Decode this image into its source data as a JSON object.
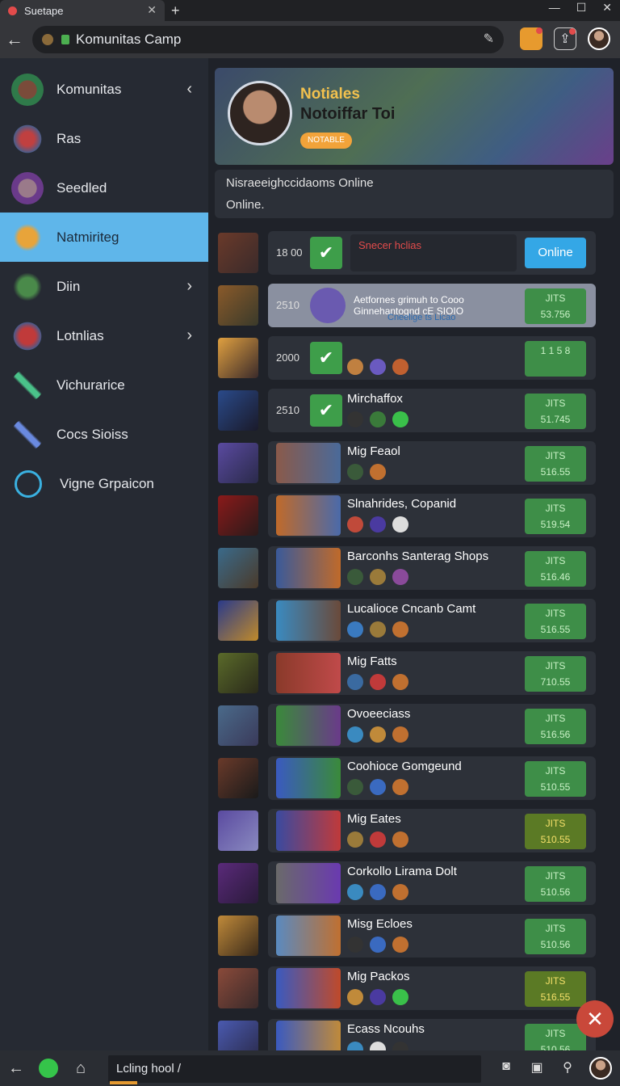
{
  "tab": {
    "title": "Suetape"
  },
  "address": {
    "url": "Komunitas Camp"
  },
  "sidebar": {
    "items": [
      {
        "label": "Komunitas",
        "icon": "shield-icon",
        "chevron": "‹"
      },
      {
        "label": "Ras",
        "icon": "warrior-icon"
      },
      {
        "label": "Seedled",
        "icon": "badge-icon"
      },
      {
        "label": "Natmiriteg",
        "icon": "star-icon",
        "active": true
      },
      {
        "label": "Diin",
        "icon": "dragon-icon",
        "chevron": "›"
      },
      {
        "label": "Lotnlias",
        "icon": "demon-icon",
        "chevron": "›"
      },
      {
        "label": "Vichurarice",
        "icon": "sword-icon"
      },
      {
        "label": "Cocs Sioiss",
        "icon": "dagger-icon"
      },
      {
        "label": "Vigne Grpaicon",
        "icon": "heart-icon"
      }
    ]
  },
  "banner": {
    "line1": "Notiales",
    "line2": "Notoiffar Toi",
    "button": "NOTABLE"
  },
  "info": {
    "line1": "Nisraeeighccidaoms Online",
    "line2": "Online."
  },
  "rows": [
    {
      "num": "18 00",
      "check": true,
      "title": "Snecer hclias",
      "online": "Online"
    },
    {
      "num": "2510",
      "title": "Aetfornes grimuh to Cooo Ginnehantognd cE SIOIO",
      "sub": "Cneelige ts Licao",
      "score1": "JITS",
      "score2": "53.756"
    },
    {
      "num": "2000",
      "check": true,
      "score1": "1 1 5 8",
      "score2": ""
    },
    {
      "num": "2510",
      "check": true,
      "title": "Mirchaffox",
      "score1": "JITS",
      "score2": "51.745"
    },
    {
      "title": "Mig Feaol",
      "score1": "JITS",
      "score2": "516.55"
    },
    {
      "title": "Slnahrides, Copanid",
      "score1": "JITS",
      "score2": "519.54"
    },
    {
      "title": "Barconhs Santerag Shops",
      "score1": "JITS",
      "score2": "516.46"
    },
    {
      "title": "Lucalioce Cncanb Camt",
      "score1": "JITS",
      "score2": "516.55"
    },
    {
      "title": "Mig Fatts",
      "score1": "JITS",
      "score2": "710.55"
    },
    {
      "title": "Ovoeeciass",
      "score1": "JITS",
      "score2": "516.56"
    },
    {
      "title": "Coohioce Gomgeund",
      "score1": "JITS",
      "score2": "510.55"
    },
    {
      "title": "Mig Eates",
      "score1": "JITS",
      "score2": "510.55",
      "gold": true
    },
    {
      "title": "Corkollo Lirama Dolt",
      "score1": "JITS",
      "score2": "510.56"
    },
    {
      "title": "Misg Ecloes",
      "score1": "JITS",
      "score2": "510.56"
    },
    {
      "title": "Mig Packos",
      "score1": "JITS",
      "score2": "516.55",
      "gold": true
    },
    {
      "title": "Ecass Ncouhs",
      "score1": "JITS",
      "score2": "510.56"
    }
  ],
  "bottom": {
    "input": "Lcling hool /"
  }
}
